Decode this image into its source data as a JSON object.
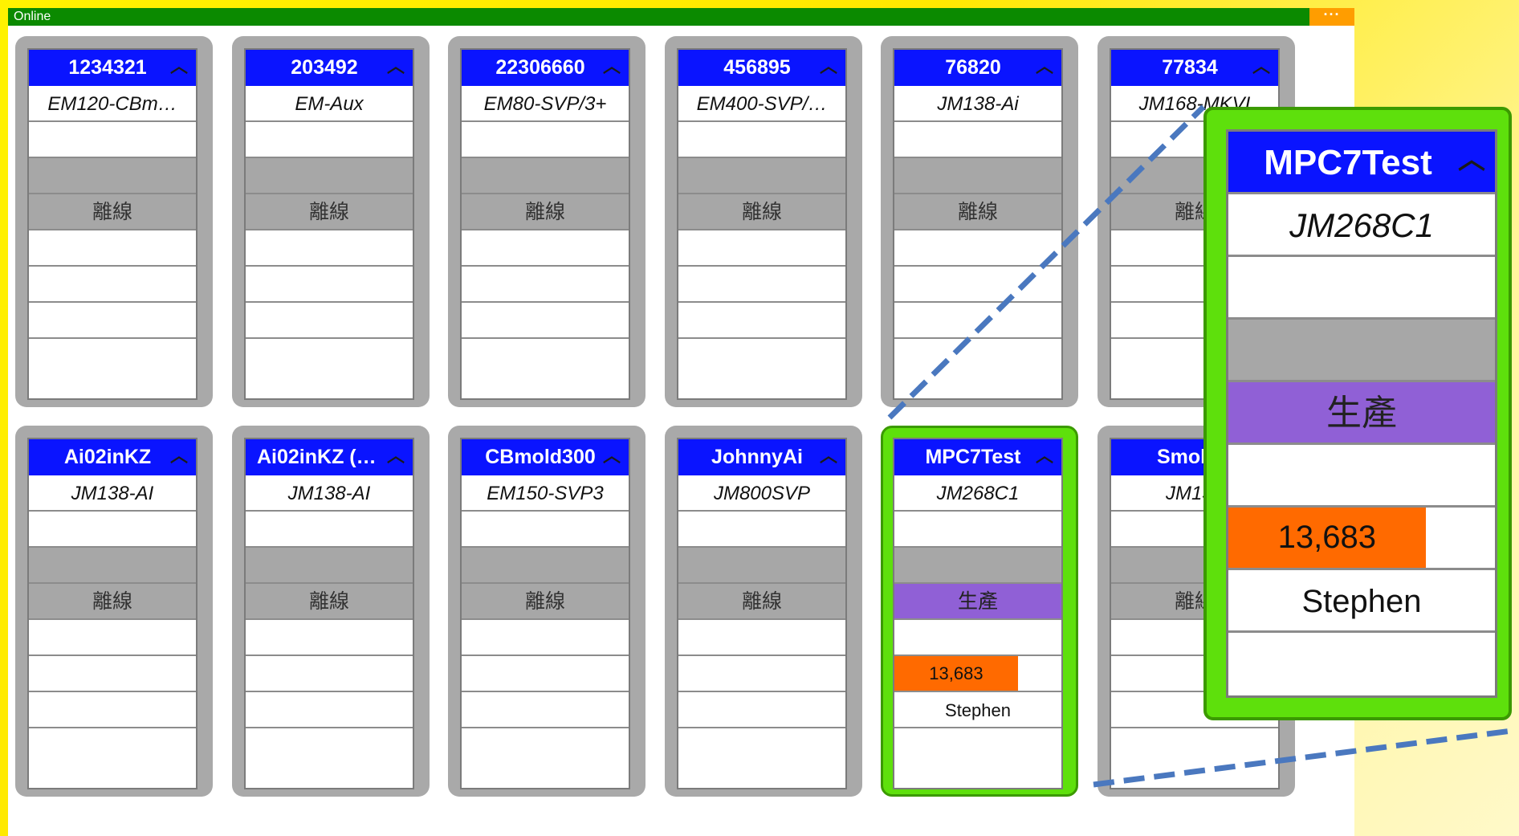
{
  "window": {
    "title": "Online",
    "menu_label": "···"
  },
  "machines": [
    {
      "id": "1234321",
      "model": "EM120-CBm…",
      "status": "離線"
    },
    {
      "id": "203492",
      "model": "EM-Aux",
      "status": "離線"
    },
    {
      "id": "22306660",
      "model": "EM80-SVP/3+",
      "status": "離線"
    },
    {
      "id": "456895",
      "model": "EM400-SVP/…",
      "status": "離線"
    },
    {
      "id": "76820",
      "model": "JM138-Ai",
      "status": "離線"
    },
    {
      "id": "77834",
      "model": "JM168-MKVI",
      "status": "離線"
    },
    {
      "id": "Ai02inKZ",
      "model": "JM138-AI",
      "status": "離線"
    },
    {
      "id": "Ai02inKZ (O…",
      "model": "JM138-AI",
      "status": "離線"
    },
    {
      "id": "CBmold300",
      "model": "EM150-SVP3",
      "status": "離線"
    },
    {
      "id": "JohnnyAi",
      "model": "JM800SVP",
      "status": "離線"
    },
    {
      "id": "MPC7Test",
      "model": "JM268C1",
      "status": "生產",
      "count": "13,683",
      "count_fraction": 0.74,
      "operator": "Stephen",
      "highlighted": true
    },
    {
      "id": "Smoke",
      "model": "JM138",
      "status": "離線"
    }
  ],
  "zoom": {
    "id": "MPC7Test",
    "model": "JM268C1",
    "status": "生產",
    "count": "13,683",
    "count_fraction": 0.74,
    "operator": "Stephen"
  },
  "colors": {
    "titlebar": "#0b8a00",
    "menu": "#ff9d00",
    "header": "#0a14ff",
    "offline": "#a7a7a7",
    "production": "#9060d6",
    "count": "#ff6a00",
    "highlight": "#5ee00c"
  },
  "icons": {
    "caret": "chevron-up-icon",
    "menu": "more-icon"
  }
}
